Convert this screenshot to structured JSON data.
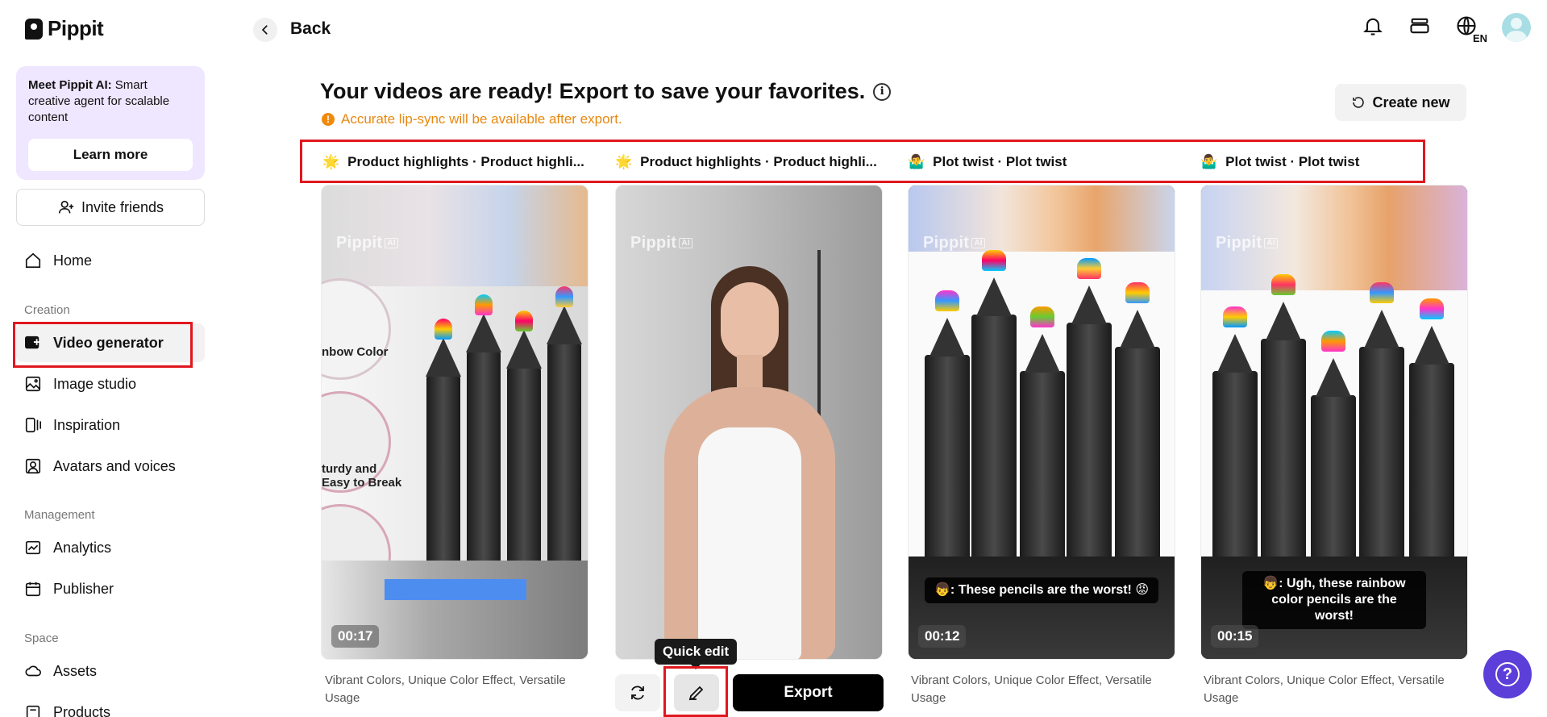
{
  "app": {
    "name": "Pippit"
  },
  "sidebar": {
    "promo": {
      "bold": "Meet Pippit AI:",
      "text": " Smart creative agent for scalable content",
      "button": "Learn more"
    },
    "invite": "Invite friends",
    "home": "Home",
    "sections": {
      "creation": "Creation",
      "management": "Management",
      "space": "Space"
    },
    "creation_items": [
      "Video generator",
      "Image studio",
      "Inspiration",
      "Avatars and voices"
    ],
    "management_items": [
      "Analytics",
      "Publisher"
    ],
    "space_items": [
      "Assets",
      "Products"
    ]
  },
  "topbar": {
    "back": "Back",
    "lang": "EN"
  },
  "main": {
    "title": "Your videos are ready! Export to save your favorites.",
    "info_icon": "i",
    "warning": "Accurate lip-sync will be available after export.",
    "create_new": "Create new",
    "tabs": [
      {
        "emoji": "🌟",
        "label": "Product highlights · Product highli..."
      },
      {
        "emoji": "🌟",
        "label": "Product highlights · Product highli..."
      },
      {
        "emoji": "🤷‍♂️",
        "label": "Plot twist · Plot twist"
      },
      {
        "emoji": "🤷‍♂️",
        "label": "Plot twist · Plot twist"
      }
    ],
    "cards": [
      {
        "duration": "00:17",
        "desc": "Vibrant Colors, Unique Color Effect, Versatile Usage",
        "overlay1": "nbow Color",
        "overlay2": "turdy and",
        "overlay3": "Easy to Break"
      },
      {
        "desc": ""
      },
      {
        "duration": "00:12",
        "caption": "👦: These pencils are the worst! 😡",
        "desc": "Vibrant Colors, Unique Color Effect, Versatile Usage"
      },
      {
        "duration": "00:15",
        "caption": "👦: Ugh, these rainbow color pencils are the worst!",
        "desc": "Vibrant Colors, Unique Color Effect, Versatile Usage"
      }
    ],
    "watermark": "Pippit",
    "watermark_badge": "AI",
    "tooltip": "Quick edit",
    "export": "Export"
  },
  "help_label": "?"
}
